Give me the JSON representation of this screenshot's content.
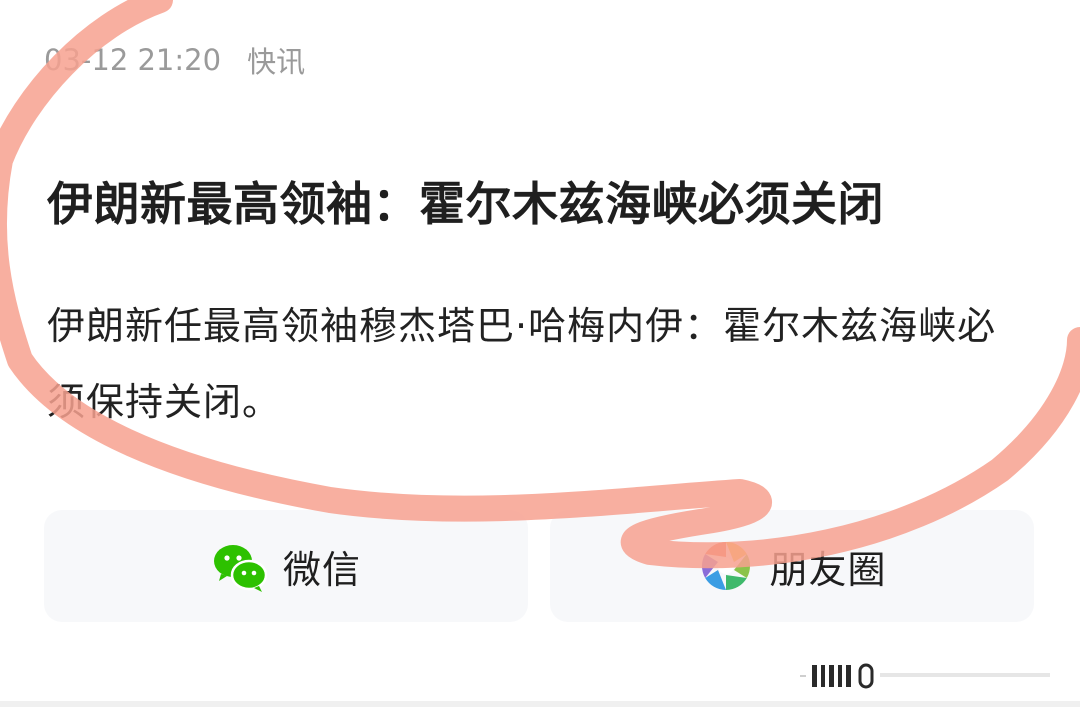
{
  "article": {
    "date_time": "03-12 21:20",
    "category": "快讯",
    "headline": "伊朗新最高领袖：霍尔木兹海峡必须关闭",
    "summary": "伊朗新任最高领袖穆杰塔巴·哈梅内伊：霍尔木兹海峡必须保持关闭。"
  },
  "share": {
    "wechat": {
      "label": "微信",
      "icon": "wechat-icon",
      "color": "#2DC100"
    },
    "moments": {
      "label": "朋友圈",
      "icon": "moments-icon"
    }
  },
  "annotation": {
    "icon": "hand-drawn-circle-annotation",
    "color": "#F7A18F"
  },
  "colors": {
    "meta_text": "#9A9A9A",
    "title_text": "#1F1F1F",
    "button_bg": "#F7F8FA"
  }
}
